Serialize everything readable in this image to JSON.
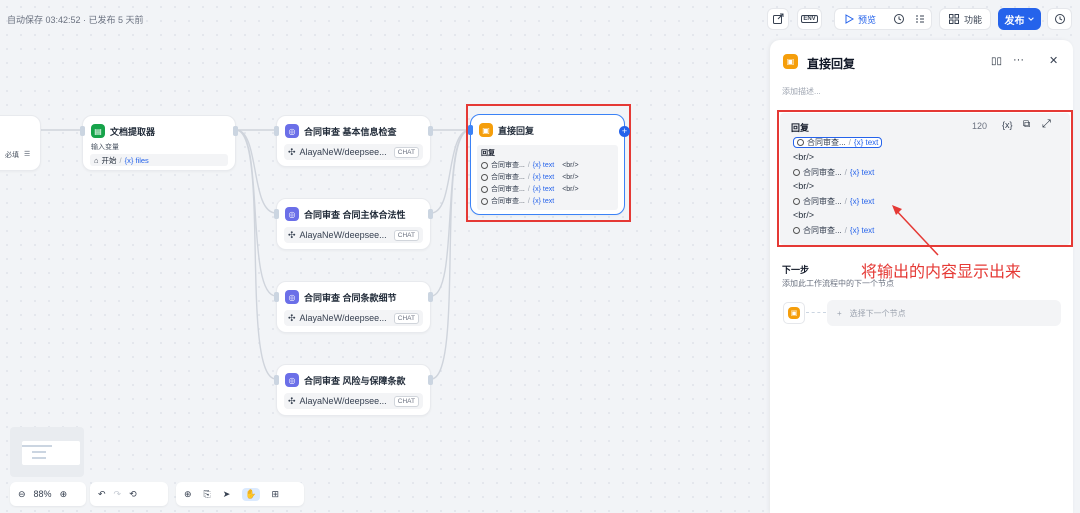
{
  "header": {
    "save_status": "自动保存 03:42:52 · 已发布 5 天前",
    "preview_label": "预览",
    "env_label": "ENV",
    "features_label": "功能",
    "publish_label": "发布"
  },
  "left_stub": {
    "label": "必填"
  },
  "nodes": {
    "extractor": {
      "title": "文档提取器",
      "input_label": "输入变量",
      "source": "开始",
      "var": "{x} files"
    },
    "llm1": {
      "title": "合同审查 基本信息检查",
      "model": "AlayaNeW/deepsee...",
      "tag": "CHAT"
    },
    "llm2": {
      "title": "合同审查 合同主体合法性",
      "model": "AlayaNeW/deepsee...",
      "tag": "CHAT"
    },
    "llm3": {
      "title": "合同审查 合同条款细节",
      "model": "AlayaNeW/deepsee...",
      "tag": "CHAT"
    },
    "llm4": {
      "title": "合同审查 风险与保障条款",
      "model": "AlayaNeW/deepsee...",
      "tag": "CHAT"
    },
    "reply": {
      "title": "直接回复",
      "section": "回复",
      "rows": [
        {
          "ref": "合同审查...",
          "var": "{x} text",
          "br": "<br/>"
        },
        {
          "ref": "合同审查...",
          "var": "{x} text",
          "br": "<br/>"
        },
        {
          "ref": "合同审查...",
          "var": "{x} text",
          "br": "<br/>"
        },
        {
          "ref": "合同审查...",
          "var": "{x} text",
          "br": ""
        }
      ]
    }
  },
  "panel": {
    "title": "直接回复",
    "description_placeholder": "添加描述...",
    "reply_label": "回复",
    "char_count": "120",
    "var_button": "{x}",
    "refs": [
      {
        "ref": "合同审查...",
        "var": "{x} text"
      },
      {
        "ref": "合同审查...",
        "var": "{x} text"
      },
      {
        "ref": "合同审查...",
        "var": "{x} text"
      },
      {
        "ref": "合同审查...",
        "var": "{x} text"
      }
    ],
    "br_text": "<br/>",
    "next_step_title": "下一步",
    "next_step_desc": "添加此工作流程中的下一个节点",
    "next_step_select": "选择下一个节点"
  },
  "annotation": "将输出的内容显示出来",
  "toolbar": {
    "zoom": "88%"
  },
  "colors": {
    "accent": "#2563eb",
    "highlight": "#e53935",
    "llm_icon": "#6b6fe8",
    "reply_icon": "#f59e0b",
    "extractor_icon": "#16a34a"
  }
}
